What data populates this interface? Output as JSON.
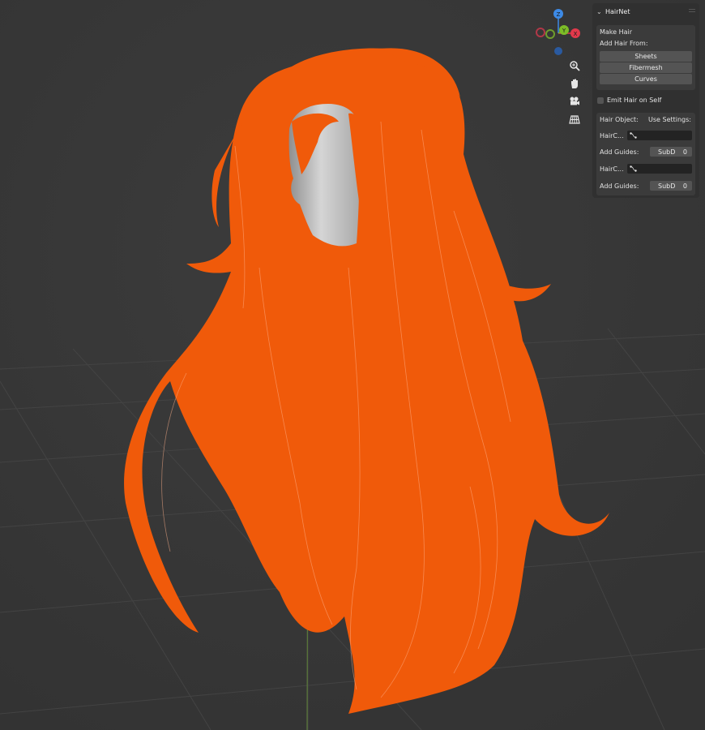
{
  "viewport": {
    "background": "#3a3a3a",
    "hair_color": "#f05a0a",
    "head_color": "#bdbdbd"
  },
  "gizmo": {
    "z_label": "Z",
    "y_label": "Y",
    "x_label": "X",
    "colors": {
      "x": "#e2394b",
      "y": "#7cbc27",
      "z": "#3d8ae6"
    }
  },
  "nav_icons": [
    "zoom-icon",
    "pan-hand-icon",
    "camera-icon",
    "grid-icon"
  ],
  "panel": {
    "title": "HairNet",
    "make_hair_label": "Make Hair",
    "add_hair_from_label": "Add Hair From:",
    "buttons": [
      "Sheets",
      "Fibermesh",
      "Curves"
    ],
    "emit_hair_label": "Emit Hair on Self",
    "emit_hair_checked": false,
    "hair_object_label": "Hair Object:",
    "use_settings_label": "Use Settings:",
    "rows": [
      {
        "hair_label": "HairC...",
        "guides_label": "Add Guides:",
        "subd_label": "SubD",
        "subd_value": "0"
      },
      {
        "hair_label": "HairC...",
        "guides_label": "Add Guides:",
        "subd_label": "SubD",
        "subd_value": "0"
      }
    ]
  }
}
